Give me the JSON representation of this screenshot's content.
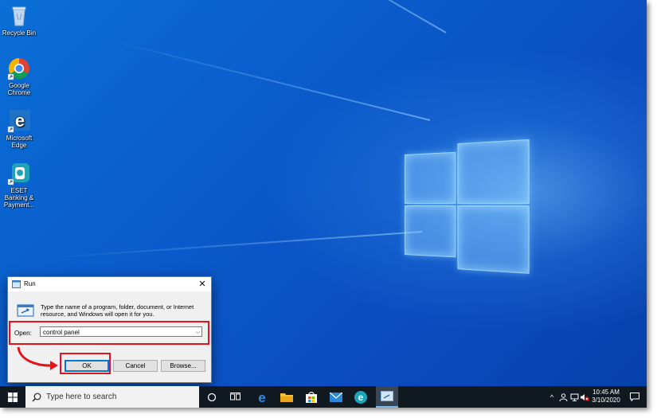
{
  "desktop": {
    "icons": [
      {
        "label": "Recycle Bin"
      },
      {
        "label": "Google Chrome"
      },
      {
        "label": "Microsoft Edge"
      },
      {
        "label": "ESET Banking & Payment..."
      }
    ]
  },
  "run_dialog": {
    "title": "Run",
    "description": "Type the name of a program, folder, document, or Internet resource, and Windows will open it for you.",
    "open_label": "Open:",
    "open_value": "control panel",
    "buttons": {
      "ok": "OK",
      "cancel": "Cancel",
      "browse": "Browse..."
    },
    "close_glyph": "✕"
  },
  "taskbar": {
    "search_placeholder": "Type here to search",
    "time": "10:45 AM",
    "date": "3/10/2020"
  },
  "colors": {
    "highlight": "#e3141c",
    "accent": "#0078d7"
  },
  "icons": {
    "start": "windows-start-icon",
    "search": "search-icon",
    "cortana": "cortana-circle-icon",
    "task_view": "task-view-icon",
    "edge": "edge-icon",
    "explorer": "file-explorer-icon",
    "store": "store-icon",
    "mail": "mail-icon",
    "eset": "eset-icon",
    "run": "run-icon",
    "notifications": "notification-icon"
  }
}
